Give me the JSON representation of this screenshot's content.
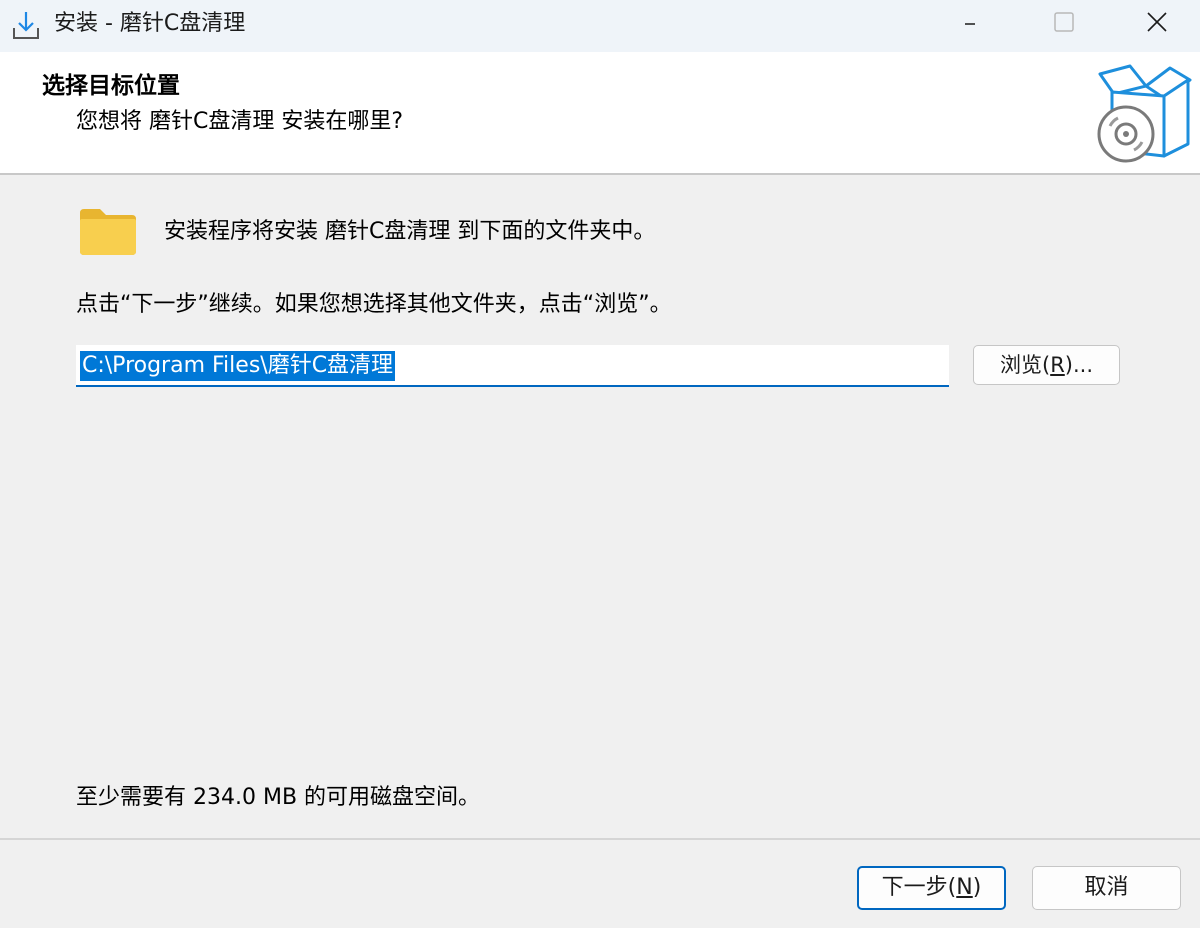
{
  "window": {
    "title": "安装 - 磨针C盘清理",
    "controls": {
      "minimize_icon": "minimize-icon",
      "maximize_icon": "maximize-icon",
      "close_icon": "close-icon"
    }
  },
  "header": {
    "title": "选择目标位置",
    "subtitle": "您想将 磨针C盘清理 安装在哪里?",
    "art_icon": "software-box-disc-icon"
  },
  "main": {
    "intro": "安装程序将安装 磨针C盘清理 到下面的文件夹中。",
    "instruction": "点击“下一步”继续。如果您想选择其他文件夹，点击“浏览”。",
    "path_value": "C:\\Program Files\\磨针C盘清理",
    "browse_label_prefix": "浏览(",
    "browse_hotkey": "R",
    "browse_label_suffix": ")...",
    "space_required": "至少需要有 234.0 MB 的可用磁盘空间。"
  },
  "footer": {
    "next_label_prefix": "下一步(",
    "next_hotkey": "N",
    "next_label_suffix": ")",
    "cancel_label": "取消"
  },
  "colors": {
    "accent": "#0067c0",
    "selection": "#0078d7",
    "folder": "#f8cf4e",
    "box_outline": "#1e8fdc"
  }
}
